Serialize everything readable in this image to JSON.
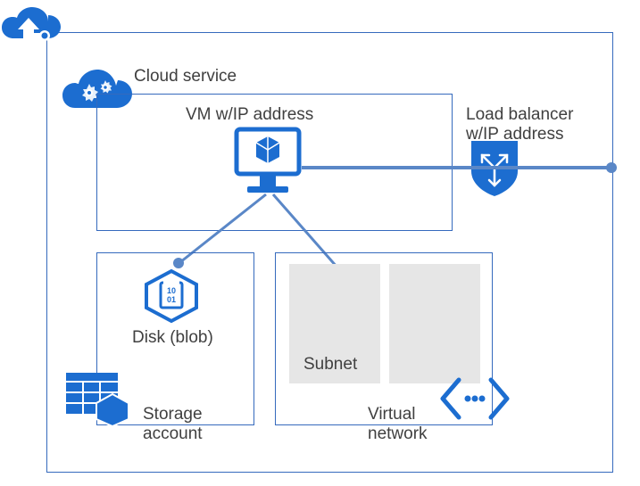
{
  "labels": {
    "cloud_service": "Cloud service",
    "vm_ip": "VM w/IP address",
    "load_balancer_l1": "Load balancer",
    "load_balancer_l2": "w/IP address",
    "disk_blob": "Disk (blob)",
    "subnet": "Subnet",
    "storage_account_l1": "Storage",
    "storage_account_l2": "account",
    "virtual_network_l1": "Virtual",
    "virtual_network_l2": "network"
  },
  "colors": {
    "brand_blue": "#1c6dd0",
    "line_blue": "#5a87c7",
    "border_blue": "#356abd",
    "panel_gray": "#e6e6e6"
  }
}
